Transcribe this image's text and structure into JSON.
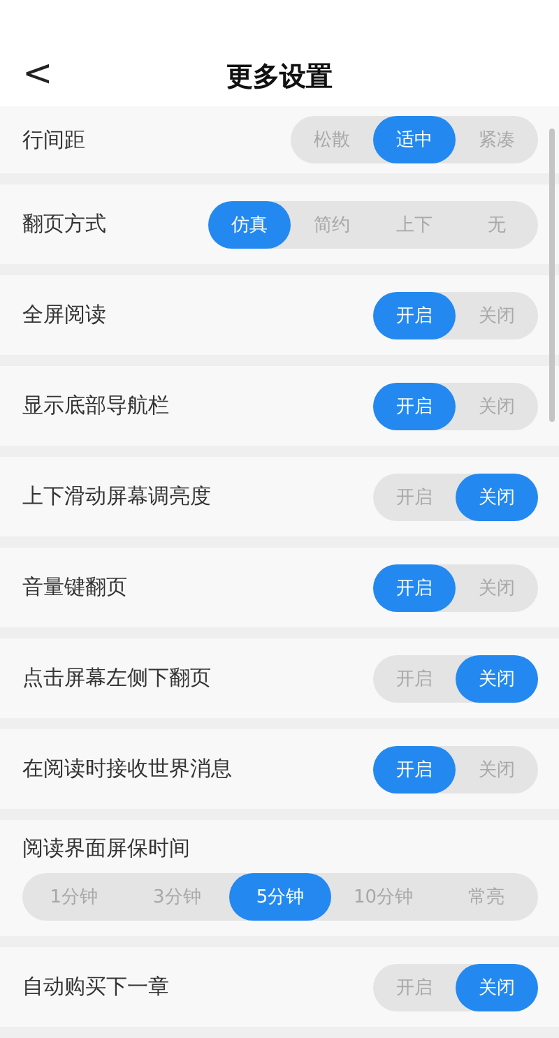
{
  "header": {
    "back": "<",
    "title": "更多设置"
  },
  "settings": [
    {
      "kind": "inline",
      "label": "行间距",
      "options": [
        {
          "label": "松散",
          "selected": false
        },
        {
          "label": "适中",
          "selected": true
        },
        {
          "label": "紧凑",
          "selected": false
        }
      ]
    },
    {
      "kind": "inline",
      "label": "翻页方式",
      "options": [
        {
          "label": "仿真",
          "selected": true
        },
        {
          "label": "简约",
          "selected": false
        },
        {
          "label": "上下",
          "selected": false
        },
        {
          "label": "无",
          "selected": false
        }
      ]
    },
    {
      "kind": "inline",
      "label": "全屏阅读",
      "options": [
        {
          "label": "开启",
          "selected": true
        },
        {
          "label": "关闭",
          "selected": false
        }
      ]
    },
    {
      "kind": "inline",
      "label": "显示底部导航栏",
      "options": [
        {
          "label": "开启",
          "selected": true
        },
        {
          "label": "关闭",
          "selected": false
        }
      ]
    },
    {
      "kind": "inline",
      "label": "上下滑动屏幕调亮度",
      "options": [
        {
          "label": "开启",
          "selected": false
        },
        {
          "label": "关闭",
          "selected": true
        }
      ]
    },
    {
      "kind": "inline",
      "label": "音量键翻页",
      "options": [
        {
          "label": "开启",
          "selected": true
        },
        {
          "label": "关闭",
          "selected": false
        }
      ]
    },
    {
      "kind": "inline",
      "label": "点击屏幕左侧下翻页",
      "options": [
        {
          "label": "开启",
          "selected": false
        },
        {
          "label": "关闭",
          "selected": true
        }
      ]
    },
    {
      "kind": "inline",
      "label": "在阅读时接收世界消息",
      "options": [
        {
          "label": "开启",
          "selected": true
        },
        {
          "label": "关闭",
          "selected": false
        }
      ]
    },
    {
      "kind": "stacked",
      "label": "阅读界面屏保时间",
      "options": [
        {
          "label": "1分钟",
          "selected": false
        },
        {
          "label": "3分钟",
          "selected": false
        },
        {
          "label": "5分钟",
          "selected": true
        },
        {
          "label": "10分钟",
          "selected": false
        },
        {
          "label": "常亮",
          "selected": false
        }
      ]
    },
    {
      "kind": "inline",
      "label": "自动购买下一章",
      "options": [
        {
          "label": "开启",
          "selected": false
        },
        {
          "label": "关闭",
          "selected": true
        }
      ]
    }
  ]
}
